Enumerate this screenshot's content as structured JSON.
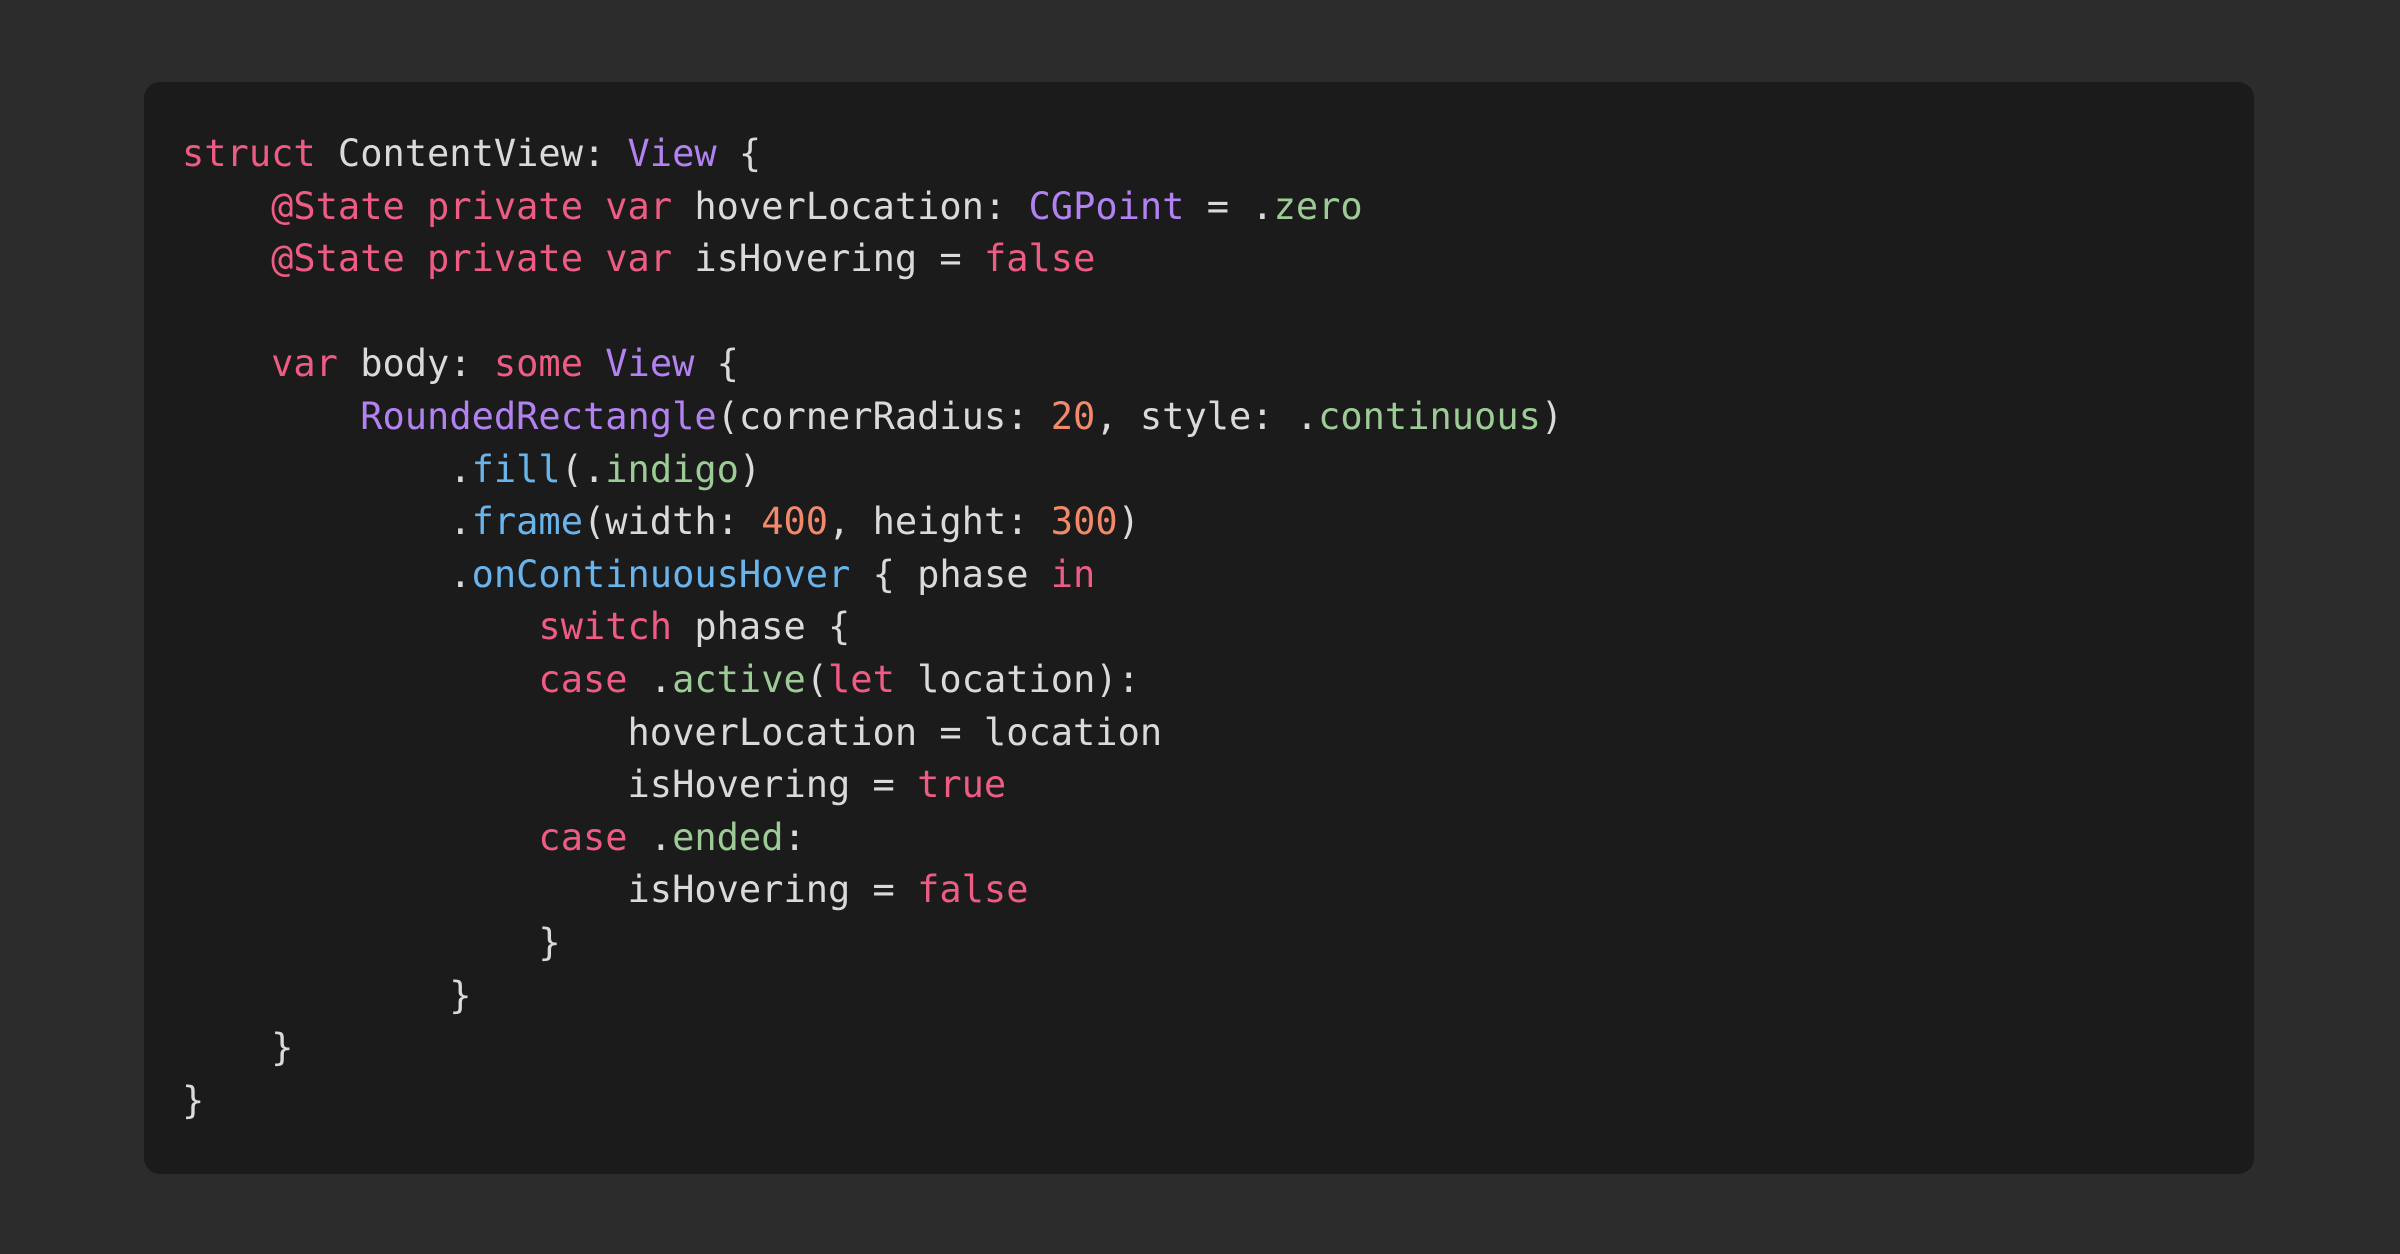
{
  "colors": {
    "background": "#2c2c2d",
    "card": "#1b1b1c",
    "plain": "#dadada",
    "keyword": "#ef5c83",
    "type": "#b282f0",
    "function": "#6ab4ec",
    "member": "#9ccb95",
    "number": "#f28a6a"
  },
  "code": {
    "language": "swift",
    "lines": [
      [
        [
          "kw",
          "struct"
        ],
        [
          "plain",
          " ContentView: "
        ],
        [
          "type",
          "View"
        ],
        [
          "plain",
          " {"
        ]
      ],
      [
        [
          "plain",
          "    "
        ],
        [
          "kw",
          "@State"
        ],
        [
          "plain",
          " "
        ],
        [
          "kw",
          "private"
        ],
        [
          "plain",
          " "
        ],
        [
          "kw",
          "var"
        ],
        [
          "plain",
          " hoverLocation: "
        ],
        [
          "type",
          "CGPoint"
        ],
        [
          "plain",
          " = ."
        ],
        [
          "member",
          "zero"
        ]
      ],
      [
        [
          "plain",
          "    "
        ],
        [
          "kw",
          "@State"
        ],
        [
          "plain",
          " "
        ],
        [
          "kw",
          "private"
        ],
        [
          "plain",
          " "
        ],
        [
          "kw",
          "var"
        ],
        [
          "plain",
          " isHovering = "
        ],
        [
          "kw",
          "false"
        ]
      ],
      [],
      [
        [
          "plain",
          "    "
        ],
        [
          "kw",
          "var"
        ],
        [
          "plain",
          " body: "
        ],
        [
          "kw",
          "some"
        ],
        [
          "plain",
          " "
        ],
        [
          "type",
          "View"
        ],
        [
          "plain",
          " {"
        ]
      ],
      [
        [
          "plain",
          "        "
        ],
        [
          "type",
          "RoundedRectangle"
        ],
        [
          "plain",
          "(cornerRadius: "
        ],
        [
          "num",
          "20"
        ],
        [
          "plain",
          ", style: ."
        ],
        [
          "member",
          "continuous"
        ],
        [
          "plain",
          ")"
        ]
      ],
      [
        [
          "plain",
          "            ."
        ],
        [
          "fn",
          "fill"
        ],
        [
          "plain",
          "(."
        ],
        [
          "member",
          "indigo"
        ],
        [
          "plain",
          ")"
        ]
      ],
      [
        [
          "plain",
          "            ."
        ],
        [
          "fn",
          "frame"
        ],
        [
          "plain",
          "(width: "
        ],
        [
          "num",
          "400"
        ],
        [
          "plain",
          ", height: "
        ],
        [
          "num",
          "300"
        ],
        [
          "plain",
          ")"
        ]
      ],
      [
        [
          "plain",
          "            ."
        ],
        [
          "fn",
          "onContinuousHover"
        ],
        [
          "plain",
          " { phase "
        ],
        [
          "kw",
          "in"
        ]
      ],
      [
        [
          "plain",
          "                "
        ],
        [
          "kw",
          "switch"
        ],
        [
          "plain",
          " phase {"
        ]
      ],
      [
        [
          "plain",
          "                "
        ],
        [
          "kw",
          "case"
        ],
        [
          "plain",
          " ."
        ],
        [
          "member",
          "active"
        ],
        [
          "plain",
          "("
        ],
        [
          "kw",
          "let"
        ],
        [
          "plain",
          " location):"
        ]
      ],
      [
        [
          "plain",
          "                    hoverLocation = location"
        ]
      ],
      [
        [
          "plain",
          "                    isHovering = "
        ],
        [
          "kw",
          "true"
        ]
      ],
      [
        [
          "plain",
          "                "
        ],
        [
          "kw",
          "case"
        ],
        [
          "plain",
          " ."
        ],
        [
          "member",
          "ended"
        ],
        [
          "plain",
          ":"
        ]
      ],
      [
        [
          "plain",
          "                    isHovering = "
        ],
        [
          "kw",
          "false"
        ]
      ],
      [
        [
          "plain",
          "                }"
        ]
      ],
      [
        [
          "plain",
          "            }"
        ]
      ],
      [
        [
          "plain",
          "    }"
        ]
      ],
      [
        [
          "plain",
          "}"
        ]
      ]
    ]
  }
}
